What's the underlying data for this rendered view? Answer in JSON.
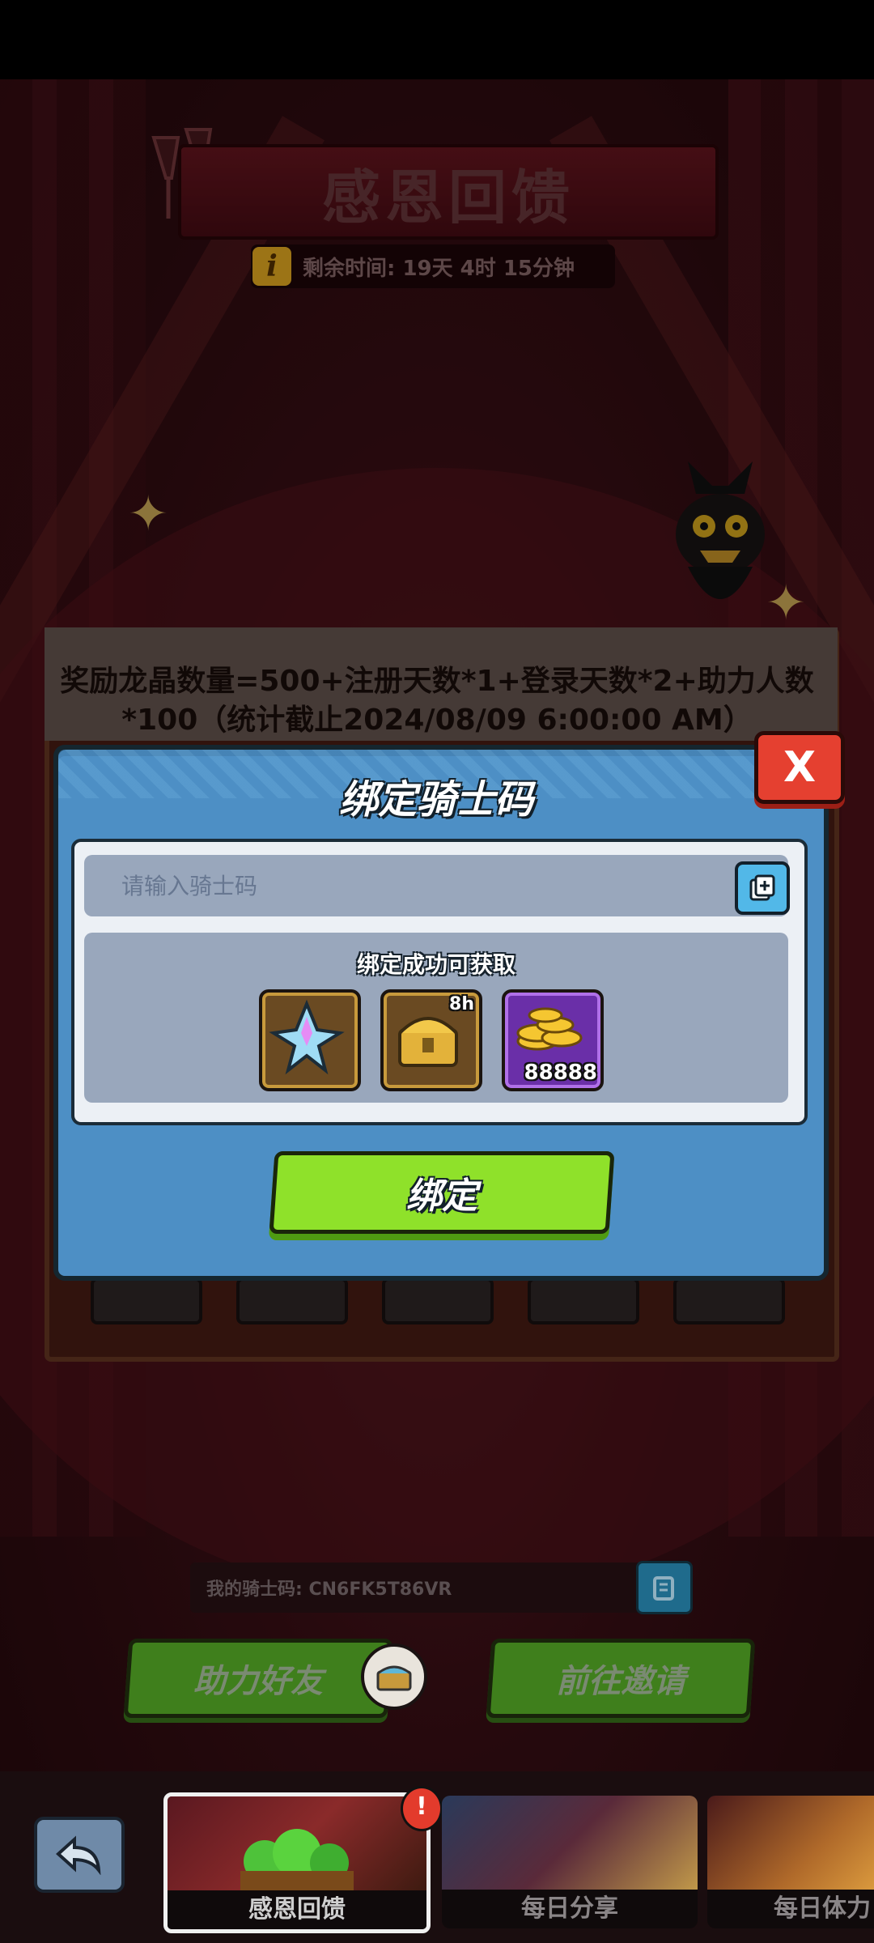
{
  "event": {
    "title": "感恩回馈",
    "remaining_time": "剩余时间: 19天 4时 15分钟",
    "formula": "奖励龙晶数量=500+注册天数*1+登录天数*2+助力人数*100（统计截止2024/08/09 6:00:00 AM）"
  },
  "modal": {
    "title": "绑定骑士码",
    "input_placeholder": "请输入骑士码",
    "rewards_title": "绑定成功可获取",
    "rewards": [
      {
        "icon": "crystal-icon",
        "badge": "",
        "count": ""
      },
      {
        "icon": "treasure-chest-icon",
        "badge": "8h",
        "count": ""
      },
      {
        "icon": "gold-coins-icon",
        "badge": "",
        "count": "88888"
      }
    ],
    "bind_label": "绑定",
    "close_label": "X"
  },
  "my_code": {
    "text": "我的骑士码: CN6FK5T86VR"
  },
  "actions": {
    "help_friend": "助力好友",
    "go_invite": "前往邀请"
  },
  "tabs": [
    {
      "label": "感恩回馈",
      "active": true
    },
    {
      "label": "每日分享",
      "active": false
    },
    {
      "label": "每日体力",
      "active": false
    }
  ],
  "tab_alert": "!",
  "colors": {
    "modal_blue": "#4d8fc5",
    "bind_green": "#8fe12a",
    "close_red": "#e54030",
    "gold": "#f0b323"
  }
}
